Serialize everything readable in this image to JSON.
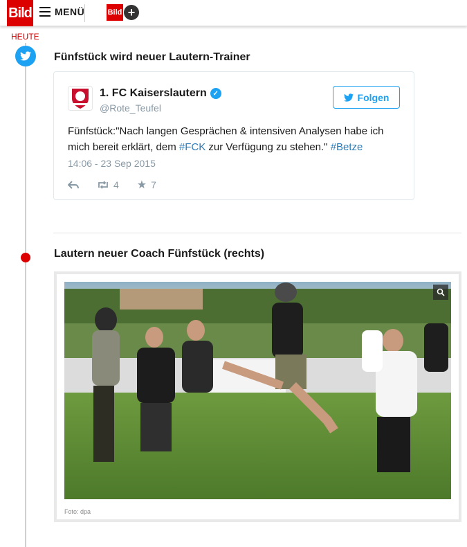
{
  "header": {
    "logo_text": "Bild",
    "menu_label": "MENÜ",
    "bildplus_text": "Bild",
    "bildplus_plus": "+"
  },
  "timeline": {
    "day_label": "HEUTE",
    "entries": [
      {
        "title": "Fünfstück wird neuer Lautern-Trainer",
        "icon": "twitter-icon",
        "tweet": {
          "name": "1. FC Kaiserslautern",
          "handle": "@Rote_Teufel",
          "follow_label": "Folgen",
          "text_part1": "Fünfstück:\"Nach langen Gesprächen & intensiven Analysen habe ich mich bereit erklärt, dem ",
          "hashtag1": "#FCK",
          "text_part2": " zur Verfügung zu stehen.\" ",
          "hashtag2": "#Betze",
          "date": "14:06 - 23 Sep 2015",
          "retweets": "4",
          "favorites": "7"
        }
      },
      {
        "title": "Lautern neuer Coach Fünfstück (rechts)",
        "caption": "Foto: dpa"
      }
    ]
  },
  "colors": {
    "brand_red": "#dd0000",
    "twitter_blue": "#1da1f2",
    "hashtag_blue": "#2b7bb9"
  }
}
